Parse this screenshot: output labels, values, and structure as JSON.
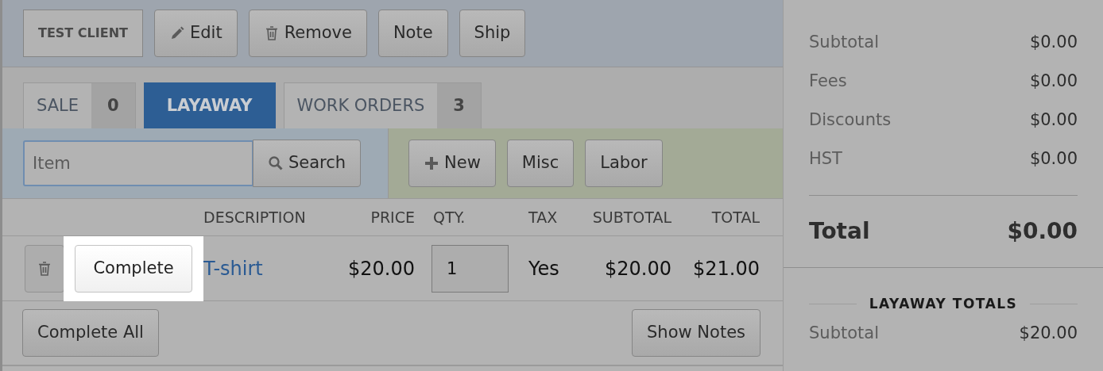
{
  "client": {
    "label": "TEST CLIENT"
  },
  "actions": [
    {
      "label": "Edit",
      "kind": "pencil"
    },
    {
      "label": "Remove",
      "kind": "trash"
    },
    {
      "label": "Note"
    },
    {
      "label": "Ship"
    }
  ],
  "tabs": [
    {
      "label": "SALE",
      "count": "0",
      "selected": false
    },
    {
      "label": "LAYAWAY",
      "selected": true
    },
    {
      "label": "WORK ORDERS",
      "count": "3",
      "selected": false
    }
  ],
  "search": {
    "placeholder": "Item",
    "button": "Search"
  },
  "add_buttons": [
    {
      "label": "New",
      "kind": "plus"
    },
    {
      "label": "Misc"
    },
    {
      "label": "Labor"
    }
  ],
  "table": {
    "columns": [
      "DESCRIPTION",
      "PRICE",
      "QTY.",
      "TAX",
      "SUBTOTAL",
      "TOTAL"
    ],
    "rows": [
      {
        "action": "Complete",
        "highlighted": true,
        "description": "T-shirt",
        "price": "$20.00",
        "qty": "1",
        "tax": "Yes",
        "subtotal": "$20.00",
        "total": "$21.00"
      }
    ]
  },
  "footer_buttons": [
    {
      "label": "Complete All"
    },
    {
      "label": "Show Notes"
    }
  ],
  "summary": {
    "lines": [
      {
        "label": "Subtotal",
        "value": "$0.00"
      },
      {
        "label": "Fees",
        "value": "$0.00"
      },
      {
        "label": "Discounts",
        "value": "$0.00"
      },
      {
        "label": "HST",
        "value": "$0.00"
      }
    ],
    "total": {
      "label": "Total",
      "value": "$0.00"
    }
  },
  "layaway_totals": {
    "title": "LAYAWAY TOTALS",
    "lines": [
      {
        "label": "Subtotal",
        "value": "$20.00"
      }
    ]
  }
}
